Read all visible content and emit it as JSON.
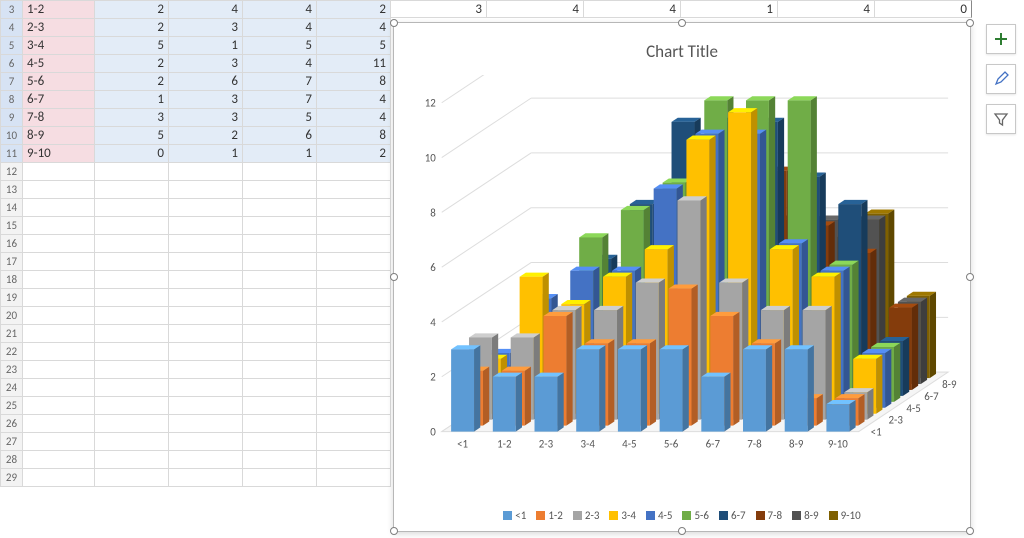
{
  "worksheet": {
    "rows": [
      {
        "rn": 3,
        "label": "1-2",
        "c": [
          2,
          4,
          4,
          2
        ],
        "sel": true
      },
      {
        "rn": 4,
        "label": "2-3",
        "c": [
          2,
          3,
          4,
          4
        ],
        "sel": true
      },
      {
        "rn": 5,
        "label": "3-4",
        "c": [
          5,
          1,
          5,
          5
        ],
        "sel": true
      },
      {
        "rn": 6,
        "label": "4-5",
        "c": [
          2,
          3,
          4,
          11
        ],
        "sel": true
      },
      {
        "rn": 7,
        "label": "5-6",
        "c": [
          2,
          6,
          7,
          8
        ],
        "sel": true
      },
      {
        "rn": 8,
        "label": "6-7",
        "c": [
          1,
          3,
          7,
          4
        ],
        "sel": true
      },
      {
        "rn": 9,
        "label": "7-8",
        "c": [
          3,
          3,
          5,
          4
        ],
        "sel": true
      },
      {
        "rn": 10,
        "label": "8-9",
        "c": [
          5,
          2,
          6,
          8
        ],
        "sel": true
      },
      {
        "rn": 11,
        "label": "9-10",
        "c": [
          0,
          1,
          1,
          2
        ],
        "sel": true
      },
      {
        "rn": 12,
        "sel": false
      },
      {
        "rn": 13,
        "sel": false
      },
      {
        "rn": 14,
        "sel": false
      },
      {
        "rn": 15,
        "sel": false
      },
      {
        "rn": 16,
        "sel": false
      },
      {
        "rn": 17,
        "sel": false
      },
      {
        "rn": 18,
        "sel": false
      },
      {
        "rn": 19,
        "sel": false
      },
      {
        "rn": 20,
        "sel": false
      },
      {
        "rn": 21,
        "sel": false
      },
      {
        "rn": 22,
        "sel": false
      },
      {
        "rn": 23,
        "sel": false
      },
      {
        "rn": 24,
        "sel": false
      },
      {
        "rn": 25,
        "sel": false
      },
      {
        "rn": 26,
        "sel": false
      },
      {
        "rn": 27,
        "sel": false
      },
      {
        "rn": 28,
        "sel": false
      },
      {
        "rn": 29,
        "sel": false
      }
    ],
    "top_extra_cells": [
      3,
      4,
      4,
      1,
      4,
      0
    ]
  },
  "chart": {
    "title": "Chart Title",
    "y_ticks": [
      0,
      2,
      4,
      6,
      8,
      10,
      12
    ],
    "x_categories": [
      "<1",
      "1-2",
      "2-3",
      "3-4",
      "4-5",
      "5-6",
      "6-7",
      "7-8",
      "8-9",
      "9-10"
    ],
    "depth_labels": [
      "<1",
      "2-3",
      "4-5",
      "6-7",
      "8-9"
    ]
  },
  "legend": [
    {
      "label": "<1",
      "color": "#5b9bd5"
    },
    {
      "label": "1-2",
      "color": "#ed7d31"
    },
    {
      "label": "2-3",
      "color": "#a5a5a5"
    },
    {
      "label": "3-4",
      "color": "#ffc000"
    },
    {
      "label": "4-5",
      "color": "#4472c4"
    },
    {
      "label": "5-6",
      "color": "#70ad47"
    },
    {
      "label": "6-7",
      "color": "#1f4e79"
    },
    {
      "label": "7-8",
      "color": "#843c0c"
    },
    {
      "label": "8-9",
      "color": "#525252"
    },
    {
      "label": "9-10",
      "color": "#7f6000"
    }
  ],
  "side_buttons": {
    "add": "+",
    "brush": "brush",
    "filter": "filter"
  },
  "chart_data": {
    "type": "3d-column",
    "title": "Chart Title",
    "xlabel": "",
    "ylabel": "",
    "zlim": [
      0,
      12
    ],
    "x_categories": [
      "<1",
      "1-2",
      "2-3",
      "3-4",
      "4-5",
      "5-6",
      "6-7",
      "7-8",
      "8-9",
      "9-10"
    ],
    "series": [
      {
        "name": "<1",
        "color": "#5b9bd5",
        "values": [
          3,
          2,
          2,
          3,
          3,
          3,
          2,
          3,
          3,
          1
        ]
      },
      {
        "name": "1-2",
        "color": "#ed7d31",
        "values": [
          2,
          2,
          4,
          3,
          3,
          5,
          4,
          3,
          1,
          1
        ]
      },
      {
        "name": "2-3",
        "color": "#a5a5a5",
        "values": [
          3,
          3,
          4,
          4,
          5,
          8,
          5,
          4,
          4,
          1
        ]
      },
      {
        "name": "3-4",
        "color": "#ffc000",
        "values": [
          2,
          5,
          4,
          5,
          6,
          10,
          11,
          6,
          5,
          2
        ]
      },
      {
        "name": "4-5",
        "color": "#4472c4",
        "values": [
          2,
          4,
          5,
          5,
          8,
          10,
          10,
          6,
          5,
          2
        ]
      },
      {
        "name": "5-6",
        "color": "#70ad47",
        "values": [
          1,
          3,
          6,
          7,
          8,
          11,
          11,
          11,
          5,
          2
        ]
      },
      {
        "name": "6-7",
        "color": "#1f4e79",
        "values": [
          1,
          2,
          5,
          7,
          10,
          10,
          10,
          8,
          7,
          2
        ]
      },
      {
        "name": "7-8",
        "color": "#843c0c",
        "values": [
          1,
          2,
          3,
          5,
          7,
          7,
          8,
          6,
          5,
          3
        ]
      },
      {
        "name": "8-9",
        "color": "#525252",
        "values": [
          0,
          1,
          2,
          3,
          5,
          6,
          6,
          6,
          6,
          3
        ]
      },
      {
        "name": "9-10",
        "color": "#7f6000",
        "values": [
          0,
          1,
          1,
          2,
          4,
          5,
          5,
          5,
          6,
          3
        ]
      }
    ]
  }
}
